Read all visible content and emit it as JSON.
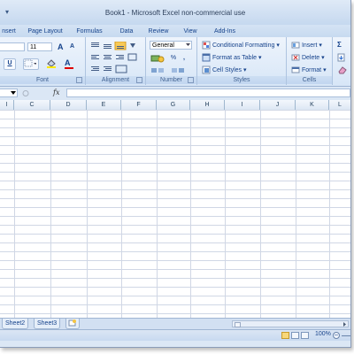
{
  "window": {
    "title": "Book1 - Microsoft Excel non-commercial use",
    "qat_dropdown": "▾"
  },
  "tabs": [
    "nsert",
    "Page Layout",
    "Formulas",
    "Data",
    "Review",
    "View",
    "Add-Ins"
  ],
  "ribbon": {
    "font": {
      "size": "11",
      "grow_label": "A",
      "shrink_label": "A",
      "bold_label": "U",
      "font_color_label": "A",
      "label": "Font"
    },
    "alignment": {
      "label": "Alignment"
    },
    "number": {
      "format": "General",
      "percent": "%",
      "comma": ",",
      "label": "Number"
    },
    "styles": {
      "conditional_formatting": "Conditional Formatting",
      "format_as_table": "Format as Table",
      "cell_styles": "Cell Styles",
      "label": "Styles"
    },
    "cells": {
      "insert": "Insert",
      "delete": "Delete",
      "format": "Format",
      "label": "Cells"
    },
    "editing": {
      "sum_label": "Σ"
    }
  },
  "formula_bar": {
    "fx_label": "fx"
  },
  "columns": [
    "I",
    "C",
    "D",
    "E",
    "F",
    "G",
    "H",
    "I",
    "J",
    "K",
    "L"
  ],
  "sheets": [
    "Sheet2",
    "Sheet3"
  ],
  "status": {
    "zoom": "100%"
  },
  "colors": {
    "accent": "#15428b",
    "ribbon": "#dbe7f5",
    "grid": "#d0d7e5"
  }
}
